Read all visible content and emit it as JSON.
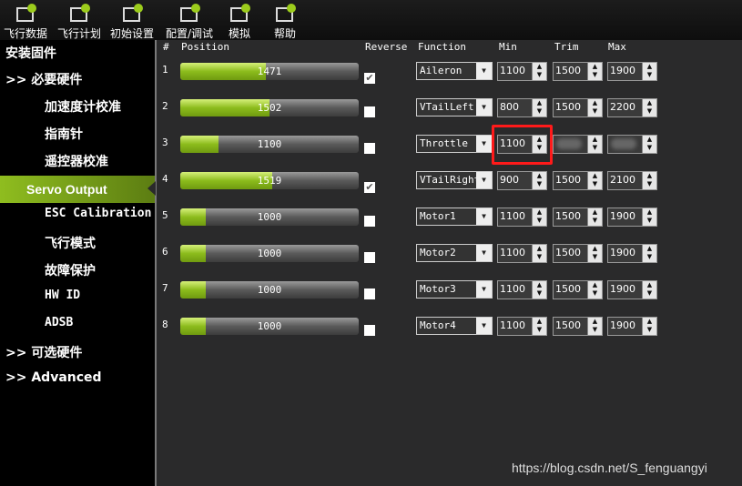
{
  "toolbar": {
    "items": [
      {
        "label": "飞行数据",
        "icon": "flight-data-icon"
      },
      {
        "label": "飞行计划",
        "icon": "flight-plan-icon"
      },
      {
        "label": "初始设置",
        "icon": "initial-setup-icon"
      },
      {
        "label": "配置/调试",
        "icon": "config-tuning-icon"
      },
      {
        "label": "模拟",
        "icon": "simulation-icon"
      },
      {
        "label": "帮助",
        "icon": "help-icon"
      }
    ]
  },
  "sidebar": {
    "items": [
      {
        "label": "安装固件"
      },
      {
        "label": ">> 必要硬件"
      },
      {
        "label": "加速度计校准"
      },
      {
        "label": "指南针"
      },
      {
        "label": "遥控器校准"
      },
      {
        "label": "Servo Output",
        "active": true
      },
      {
        "label": "ESC Calibration"
      },
      {
        "label": "飞行模式"
      },
      {
        "label": "故障保护"
      },
      {
        "label": "HW ID"
      },
      {
        "label": "ADSB"
      },
      {
        "label": ">> 可选硬件"
      },
      {
        "label": ">> Advanced"
      }
    ]
  },
  "table": {
    "headers": {
      "num": "#",
      "position": "Position",
      "reverse": "Reverse",
      "function": "Function",
      "min": "Min",
      "trim": "Trim",
      "max": "Max"
    },
    "position_range": [
      800,
      2200
    ],
    "accent": "#8cbc1c",
    "rows": [
      {
        "num": "1",
        "position": "1471",
        "reverse": true,
        "function": "Aileron",
        "min": "1100",
        "trim": "1500",
        "max": "1900"
      },
      {
        "num": "2",
        "position": "1502",
        "reverse": false,
        "function": "VTailLeft",
        "min": "800",
        "trim": "1500",
        "max": "2200"
      },
      {
        "num": "3",
        "position": "1100",
        "reverse": false,
        "function": "Throttle",
        "min": "1100",
        "trim": null,
        "max": null,
        "highlight": true
      },
      {
        "num": "4",
        "position": "1519",
        "reverse": true,
        "function": "VTailRight",
        "min": "900",
        "trim": "1500",
        "max": "2100"
      },
      {
        "num": "5",
        "position": "1000",
        "reverse": false,
        "function": "Motor1",
        "min": "1100",
        "trim": "1500",
        "max": "1900"
      },
      {
        "num": "6",
        "position": "1000",
        "reverse": false,
        "function": "Motor2",
        "min": "1100",
        "trim": "1500",
        "max": "1900"
      },
      {
        "num": "7",
        "position": "1000",
        "reverse": false,
        "function": "Motor3",
        "min": "1100",
        "trim": "1500",
        "max": "1900"
      },
      {
        "num": "8",
        "position": "1000",
        "reverse": false,
        "function": "Motor4",
        "min": "1100",
        "trim": "1500",
        "max": "1900"
      }
    ]
  },
  "watermark": "https://blog.csdn.net/S_fenguangyi"
}
